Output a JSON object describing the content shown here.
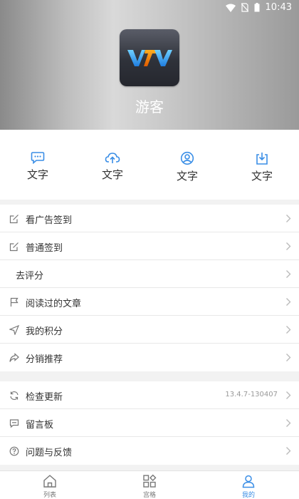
{
  "status_bar": {
    "time": "10:43"
  },
  "profile": {
    "username": "游客",
    "logo_text": "VTV"
  },
  "quick_actions": [
    {
      "label": "文字",
      "icon": "chat-bubble-icon"
    },
    {
      "label": "文字",
      "icon": "cloud-upload-icon"
    },
    {
      "label": "文字",
      "icon": "user-circle-icon"
    },
    {
      "label": "文字",
      "icon": "download-box-icon"
    }
  ],
  "menu_group_1": [
    {
      "label": "看广告签到",
      "icon": "edit-square-icon"
    },
    {
      "label": "普通签到",
      "icon": "edit-square-icon"
    },
    {
      "label": "去评分",
      "icon": ""
    },
    {
      "label": "阅读过的文章",
      "icon": "flag-icon"
    },
    {
      "label": "我的积分",
      "icon": "paper-plane-icon"
    },
    {
      "label": "分销推荐",
      "icon": "share-arrow-icon"
    }
  ],
  "menu_group_2": [
    {
      "label": "检查更新",
      "icon": "refresh-icon",
      "meta": "13.4.7-130407"
    },
    {
      "label": "留言板",
      "icon": "message-icon"
    },
    {
      "label": "问题与反馈",
      "icon": "question-circle-icon"
    }
  ],
  "tabbar": {
    "tabs": [
      {
        "label": "列表",
        "icon": "home-icon",
        "active": false
      },
      {
        "label": "宫格",
        "icon": "grid-icon",
        "active": false
      },
      {
        "label": "我的",
        "icon": "person-icon",
        "active": true
      }
    ]
  },
  "colors": {
    "accent": "#3a8ee6",
    "text": "#333333",
    "muted": "#999999"
  }
}
